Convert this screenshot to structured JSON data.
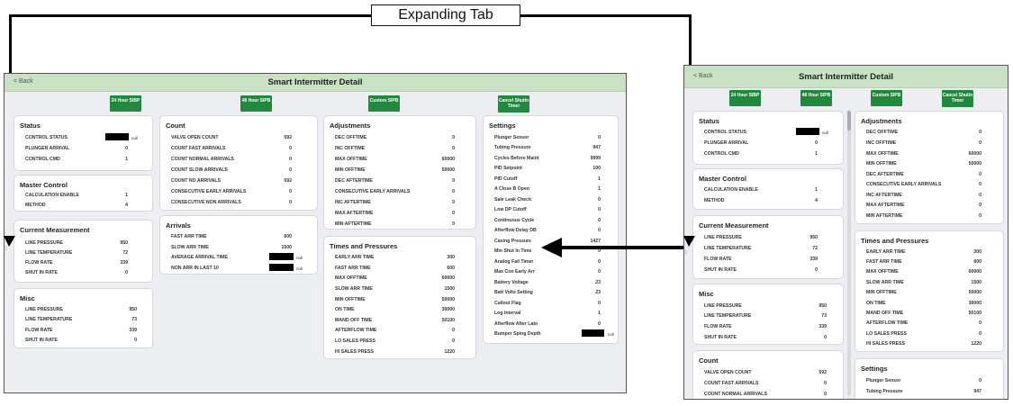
{
  "callout": {
    "label": "Expanding Tab"
  },
  "title": "Smart Intermitter Detail",
  "back_label": "< Back",
  "buttons": [
    {
      "label": "24 Hour SIBP"
    },
    {
      "label": "48 Hour SIPB"
    },
    {
      "label": "Custom SIPB"
    },
    {
      "label": "Cancel Shutin Timer"
    }
  ],
  "null_text": "null",
  "sections": {
    "status": {
      "title": "Status",
      "rows": [
        {
          "label": "CONTROL STATUS",
          "value": ""
        },
        {
          "label": "PLUNGER ARRIVAL",
          "value": "0"
        },
        {
          "label": "CONTROL CMD",
          "value": "1"
        }
      ]
    },
    "master_control": {
      "title": "Master Control",
      "rows": [
        {
          "label": "CALCULATION ENABLE",
          "value": "1"
        },
        {
          "label": "METHOD",
          "value": "4"
        }
      ]
    },
    "current_measurement": {
      "title": "Current Measurement",
      "rows": [
        {
          "label": "LINE PRESSURE",
          "value": "950"
        },
        {
          "label": "LINE TEMPERATURE",
          "value": "72"
        },
        {
          "label": "FLOW RATE",
          "value": "339"
        },
        {
          "label": "SHUT IN RATE",
          "value": "0"
        }
      ]
    },
    "misc": {
      "title": "Misc",
      "rows": [
        {
          "label": "LINE PRESSURE",
          "value": "950"
        },
        {
          "label": "LINE TEMPERATURE",
          "value": "73"
        },
        {
          "label": "FLOW RATE",
          "value": "339"
        },
        {
          "label": "SHUT IN RATE",
          "value": "0"
        }
      ]
    },
    "count": {
      "title": "Count",
      "rows": [
        {
          "label": "VALVE OPEN COUNT",
          "value": "592"
        },
        {
          "label": "COUNT FAST ARRIVALS",
          "value": "0"
        },
        {
          "label": "COUNT NORMAL ARRIVALS",
          "value": "0"
        },
        {
          "label": "COUNT SLOW ARRIVALS",
          "value": "0"
        },
        {
          "label": "COUNT NO ARRIVALS",
          "value": "592"
        },
        {
          "label": "CONSECUTIVE EARLY ARRIVALS",
          "value": "0"
        },
        {
          "label": "CONSECUTIVE NON ARRIVALS",
          "value": "0"
        }
      ]
    },
    "arrivals": {
      "title": "Arrivals",
      "rows": [
        {
          "label": "FAST ARR TIME",
          "value": "600"
        },
        {
          "label": "SLOW ARR TIME",
          "value": "1500"
        },
        {
          "label": "AVERAGE ARRIVAL TIME",
          "value": ""
        },
        {
          "label": "NON ARR IN LAST 10",
          "value": ""
        }
      ]
    },
    "adjustments": {
      "title": "Adjustments",
      "rows": [
        {
          "label": "DEC OFFTIME",
          "value": "0"
        },
        {
          "label": "INC OFFTIME",
          "value": "0"
        },
        {
          "label": "MAX OFFTIME",
          "value": "60000"
        },
        {
          "label": "MIN OFFTIME",
          "value": "50000"
        },
        {
          "label": "DEC AFTERTIME",
          "value": "0"
        },
        {
          "label": "CONSECUTIVE EARLY ARRIVALS",
          "value": "0"
        },
        {
          "label": "INC AFTERTIME",
          "value": "0"
        },
        {
          "label": "MAX AFTERTIME",
          "value": "0"
        },
        {
          "label": "MIN AFTERTIME",
          "value": "0"
        }
      ]
    },
    "times_pressures": {
      "title": "Times and Pressures",
      "rows": [
        {
          "label": "EARLY ARR TIME",
          "value": "300"
        },
        {
          "label": "FAST ARR TIME",
          "value": "600"
        },
        {
          "label": "MAX OFFTIME",
          "value": "60000"
        },
        {
          "label": "SLOW ARR TIME",
          "value": "1500"
        },
        {
          "label": "MIN OFFTIME",
          "value": "50000"
        },
        {
          "label": "ON TIME",
          "value": "30000"
        },
        {
          "label": "MAND OFF TIME",
          "value": "50100"
        },
        {
          "label": "AFTERFLOW TIME",
          "value": "0"
        },
        {
          "label": "LO SALES PRESS",
          "value": "0"
        },
        {
          "label": "HI SALES PRESS",
          "value": "1220"
        }
      ]
    },
    "settings": {
      "title": "Settings",
      "rows": [
        {
          "label": "Plunger Sensor",
          "value": "0"
        },
        {
          "label": "Tubing Pressure",
          "value": "947"
        },
        {
          "label": "Cycles Before Maint",
          "value": "9999"
        },
        {
          "label": "PID Setpoint",
          "value": "100"
        },
        {
          "label": "PID Cutoff",
          "value": "1"
        },
        {
          "label": "A Close B Open",
          "value": "1"
        },
        {
          "label": "Sale Leak Check",
          "value": "0"
        },
        {
          "label": "Low DP Cutoff",
          "value": "0"
        },
        {
          "label": "Continuous Cycle",
          "value": "0"
        },
        {
          "label": "Afterflow Delay DB",
          "value": "0"
        },
        {
          "label": "Casing Pressure",
          "value": "1427"
        },
        {
          "label": "Min Shut In Time",
          "value": "0"
        },
        {
          "label": "Analog Fail Timer",
          "value": "0"
        },
        {
          "label": "Max Con Early Arr",
          "value": "0"
        },
        {
          "label": "Battery Voltage",
          "value": "23"
        },
        {
          "label": "Batt Volts Setting",
          "value": "23"
        },
        {
          "label": "Callout Flag",
          "value": "0"
        },
        {
          "label": "Log Interval",
          "value": "1"
        },
        {
          "label": "Afterflow After Lato",
          "value": "0"
        },
        {
          "label": "Bumper Sping Depth",
          "value": ""
        }
      ]
    }
  },
  "mobile_settings_rows": [
    {
      "label": "Plunger Sensor",
      "value": "0"
    },
    {
      "label": "Tubing Pressure",
      "value": "947"
    }
  ],
  "mobile_count_rows": [
    {
      "label": "VALVE OPEN COUNT",
      "value": "592"
    },
    {
      "label": "COUNT FAST ARRIVALS",
      "value": "0"
    },
    {
      "label": "COUNT NORMAL ARRIVALS",
      "value": "0"
    }
  ]
}
